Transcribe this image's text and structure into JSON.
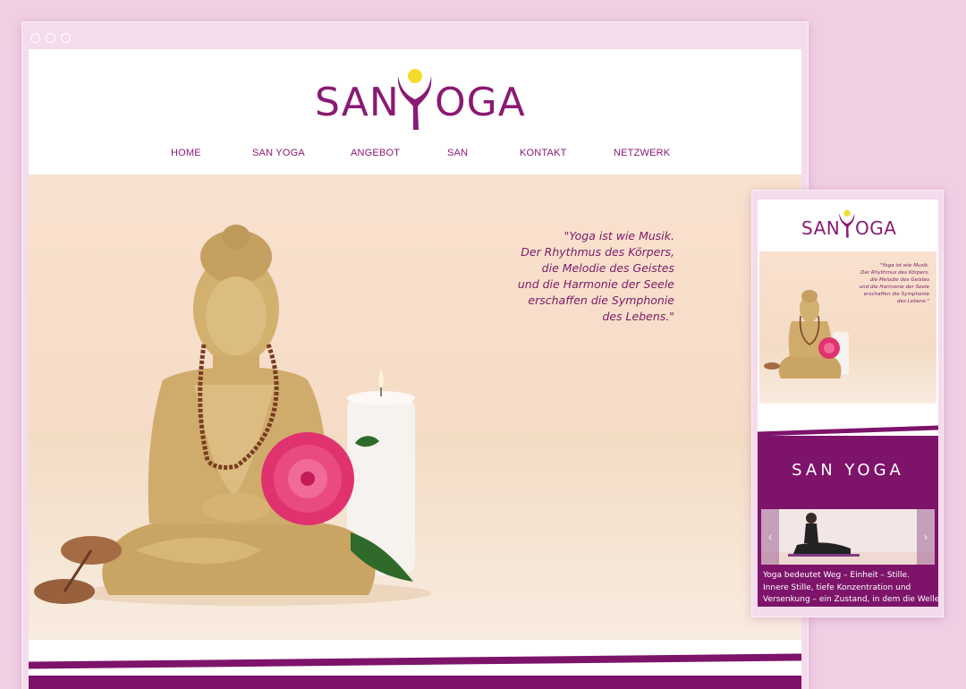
{
  "brand": {
    "name_left": "SAN",
    "name_right": "OGA",
    "primary_color": "#8a1a73",
    "accent_color": "#f4dc2e"
  },
  "nav": {
    "items": [
      {
        "label": "HOME"
      },
      {
        "label": "SAN YOGA"
      },
      {
        "label": "ANGEBOT"
      },
      {
        "label": "SAN"
      },
      {
        "label": "KONTAKT"
      },
      {
        "label": "NETZWERK"
      }
    ]
  },
  "hero": {
    "quote_lines": [
      "\"Yoga ist wie Musik.",
      "Der Rhythmus des Körpers,",
      "die Melodie des Geistes",
      "und die Harmonie der Seele",
      "erschaffen die Symphonie",
      "des Lebens.\""
    ]
  },
  "mobile": {
    "section_title": "SAN YOGA",
    "prev_label": "‹",
    "next_label": "›",
    "text_lines": [
      "Yoga bedeutet Weg – Einheit – Stille.",
      "Innere Stille, tiefe Konzentration und",
      "Versenkung – ein Zustand, in dem die Wellen"
    ]
  }
}
